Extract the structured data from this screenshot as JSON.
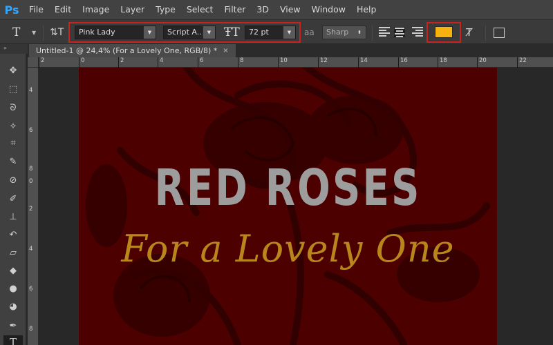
{
  "app": {
    "logo": "Ps",
    "menu": [
      "File",
      "Edit",
      "Image",
      "Layer",
      "Type",
      "Select",
      "Filter",
      "3D",
      "View",
      "Window",
      "Help"
    ]
  },
  "options_bar": {
    "tool_icon": "type-tool-icon",
    "font_family": "Pink Lady",
    "font_style": "Script A...",
    "font_size": "72 pt",
    "antialias": "Sharp",
    "text_color": "#f7b20f",
    "highlight_color": "#c8231f",
    "aa_label": "aa"
  },
  "document": {
    "tab_title": "Untitled-1 @ 24,4% (For a Lovely One, RGB/8) *",
    "close": "×"
  },
  "ruler": {
    "h_ticks": [
      "2",
      "0",
      "2",
      "4",
      "6",
      "8",
      "10",
      "12",
      "14",
      "16",
      "18",
      "20",
      "22"
    ],
    "v_ticks": [
      "4",
      "6",
      "8",
      "0",
      "2",
      "4",
      "6",
      "8"
    ]
  },
  "artwork": {
    "background_color": "#4d0000",
    "headline": "RED ROSES",
    "subline": "For a Lovely One",
    "headline_color": "#9d9d9d",
    "subline_color": "#b8861a"
  },
  "tools": [
    "move-tool-icon",
    "marquee-tool-icon",
    "lasso-tool-icon",
    "magic-wand-icon",
    "crop-tool-icon",
    "eyedropper-icon",
    "healing-brush-icon",
    "brush-tool-icon",
    "clone-stamp-icon",
    "history-brush-icon",
    "eraser-icon",
    "paint-bucket-icon",
    "blur-tool-icon",
    "dodge-tool-icon",
    "pen-tool-icon",
    "type-tool-icon"
  ]
}
